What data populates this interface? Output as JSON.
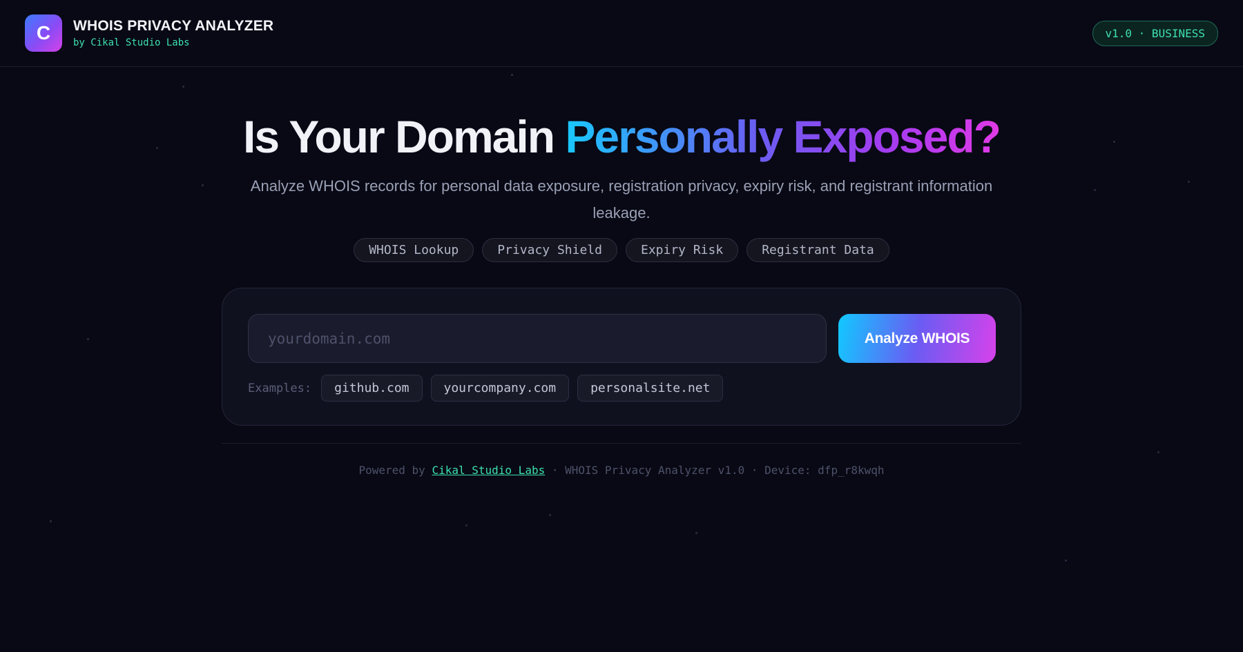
{
  "header": {
    "logo_letter": "C",
    "title": "WHOIS PRIVACY ANALYZER",
    "subtitle": "by Cikal Studio Labs",
    "version_badge": "v1.0 · BUSINESS"
  },
  "hero": {
    "title_plain": "Is Your Domain ",
    "title_highlight": "Personally Exposed?",
    "subtitle": "Analyze WHOIS records for personal data exposure, registration privacy, expiry risk, and registrant information leakage.",
    "tags": [
      "WHOIS Lookup",
      "Privacy Shield",
      "Expiry Risk",
      "Registrant Data"
    ]
  },
  "search": {
    "placeholder": "yourdomain.com",
    "value": "",
    "button_label": "Analyze WHOIS",
    "examples_label": "Examples:",
    "examples": [
      "github.com",
      "yourcompany.com",
      "personalsite.net"
    ]
  },
  "footer": {
    "prefix": "Powered by",
    "link_text": "Cikal Studio Labs",
    "suffix": "· WHOIS Privacy Analyzer v1.0 · Device: dfp_r8kwqh"
  },
  "colors": {
    "background": "#080914",
    "accent_green": "#3ee0b0",
    "gradient_start": "#19c8ff",
    "gradient_mid": "#6c5cf2",
    "gradient_end": "#e03ae6"
  }
}
